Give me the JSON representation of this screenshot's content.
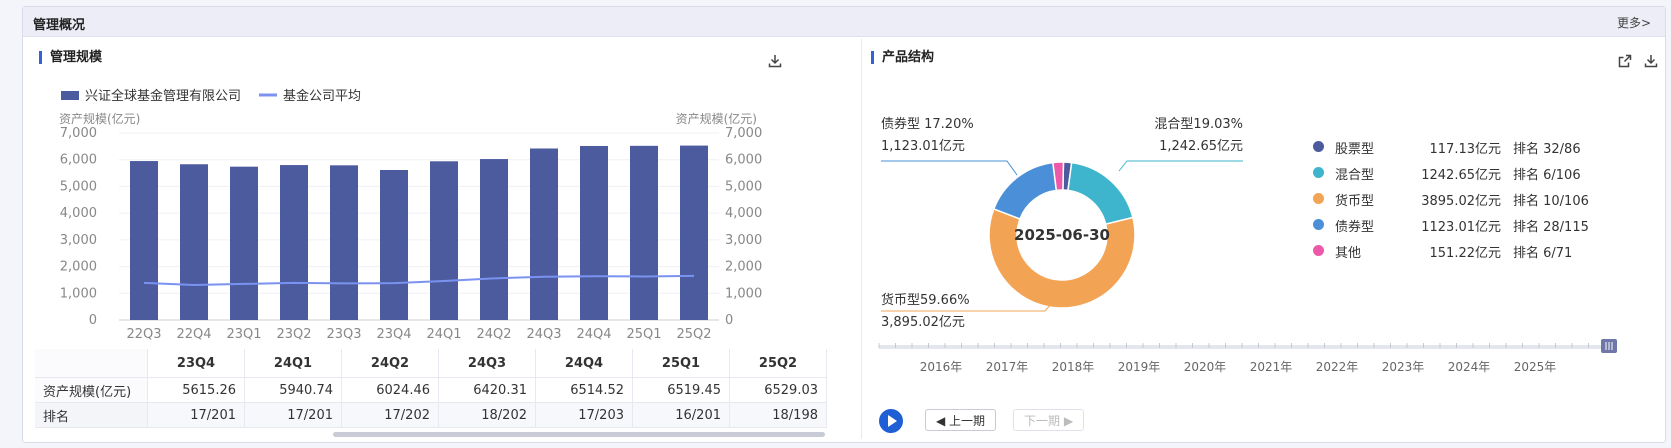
{
  "section": {
    "title": "管理概况",
    "more": "更多>"
  },
  "left": {
    "title": "管理规模",
    "download_icon": "download-icon",
    "legend": {
      "bar": "兴证全球基金管理有限公司",
      "line": "基金公司平均"
    },
    "table": {
      "columns": [
        "23Q4",
        "24Q1",
        "24Q2",
        "24Q3",
        "24Q4",
        "25Q1",
        "25Q2"
      ],
      "rows": [
        {
          "label": "资产规模(亿元)",
          "values": [
            "5615.26",
            "5940.74",
            "6024.46",
            "6420.31",
            "6514.52",
            "6519.45",
            "6529.03"
          ]
        },
        {
          "label": "排名",
          "values": [
            "17/201",
            "17/201",
            "17/202",
            "18/202",
            "17/203",
            "16/201",
            "18/198"
          ]
        }
      ]
    }
  },
  "chart_data": [
    {
      "type": "bar",
      "categories": [
        "22Q3",
        "22Q4",
        "23Q1",
        "23Q2",
        "23Q3",
        "23Q4",
        "24Q1",
        "24Q2",
        "24Q3",
        "24Q4",
        "25Q1",
        "25Q2"
      ],
      "series": [
        {
          "name": "兴证全球基金管理有限公司",
          "type": "bar",
          "values": [
            5950,
            5830,
            5740,
            5800,
            5790,
            5615.26,
            5940.74,
            6024.46,
            6420.31,
            6514.52,
            6519.45,
            6529.03
          ]
        },
        {
          "name": "基金公司平均",
          "type": "line",
          "values": [
            1390,
            1310,
            1350,
            1390,
            1370,
            1380,
            1460,
            1560,
            1620,
            1640,
            1630,
            1650
          ]
        }
      ],
      "ylabel_left": "资产规模(亿元)",
      "ylabel_right": "资产规模(亿元)",
      "yticks": [
        "7,000",
        "6,000",
        "5,000",
        "4,000",
        "3,000",
        "2,000",
        "1,000",
        "0"
      ],
      "ylim": [
        0,
        7000
      ],
      "colors": {
        "bar": "#4c5a9e",
        "line": "#7b93f0"
      },
      "legend_position": "top-left",
      "grid": true
    },
    {
      "type": "pie",
      "center_label": "2025-06-30",
      "slices": [
        {
          "name": "股票型",
          "value": 117.13,
          "color": "#4c5a9e"
        },
        {
          "name": "混合型",
          "value": 1242.65,
          "color": "#3eb5cc"
        },
        {
          "name": "货币型",
          "value": 3895.02,
          "color": "#f3a354"
        },
        {
          "name": "债券型",
          "value": 1123.01,
          "color": "#4a8fd8"
        },
        {
          "name": "其他",
          "value": 151.22,
          "color": "#eb59a8"
        }
      ],
      "callouts": [
        {
          "pct": "混合型19.03%",
          "amt": "1,242.65亿元"
        },
        {
          "pct": "债券型 17.20%",
          "amt": "1,123.01亿元"
        },
        {
          "pct": "货币型59.66%",
          "amt": "3,895.02亿元"
        }
      ]
    }
  ],
  "right": {
    "title": "产品结构",
    "export_icon": "external-link-icon",
    "download_icon": "download-icon",
    "legend": [
      {
        "name": "股票型",
        "value": "117.13亿元",
        "rank": "排名 32/86",
        "color": "#4c5a9e"
      },
      {
        "name": "混合型",
        "value": "1242.65亿元",
        "rank": "排名 6/106",
        "color": "#3eb5cc"
      },
      {
        "name": "货币型",
        "value": "3895.02亿元",
        "rank": "排名 10/106",
        "color": "#f3a354"
      },
      {
        "name": "债券型",
        "value": "1123.01亿元",
        "rank": "排名 28/115",
        "color": "#4a8fd8"
      },
      {
        "name": "其他",
        "value": "151.22亿元",
        "rank": "排名 6/71",
        "color": "#eb59a8"
      }
    ],
    "timeline": {
      "years": [
        "2016年",
        "2017年",
        "2018年",
        "2019年",
        "2020年",
        "2021年",
        "2022年",
        "2023年",
        "2024年",
        "2025年"
      ],
      "prev": "◀ 上一期",
      "next": "下一期 ▶"
    }
  }
}
